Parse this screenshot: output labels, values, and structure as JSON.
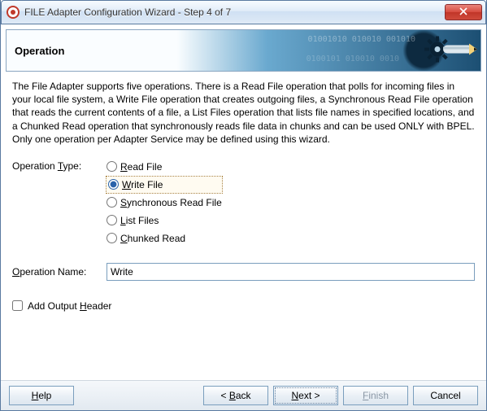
{
  "window": {
    "title": "FILE Adapter Configuration Wizard - Step 4 of 7"
  },
  "header": {
    "title": "Operation"
  },
  "description": "The File Adapter supports five operations.  There is a Read File operation that polls for incoming files in your local file system, a Write File operation that creates outgoing files, a Synchronous Read File operation that reads the current contents of a file, a List Files operation that lists file names in specified locations, and a Chunked Read operation that synchronously reads file data in chunks and can be used ONLY with BPEL. Only one operation per Adapter Service may be defined using this wizard.",
  "form": {
    "operation_type_label": "Operation Type:",
    "operation_type_mnemonic": "T",
    "radios": [
      {
        "text": "Read File",
        "mnemonic": "R",
        "selected": false
      },
      {
        "text": "Write File",
        "mnemonic": "W",
        "selected": true
      },
      {
        "text": "Synchronous Read File",
        "mnemonic": "S",
        "selected": false
      },
      {
        "text": "List Files",
        "mnemonic": "L",
        "selected": false
      },
      {
        "text": "Chunked Read",
        "mnemonic": "C",
        "selected": false
      }
    ],
    "operation_name_label": "Operation Name:",
    "operation_name_mnemonic": "O",
    "operation_name_value": "Write",
    "add_output_header_label": "Add Output Header",
    "add_output_header_mnemonic": "H",
    "add_output_header_checked": false
  },
  "buttons": {
    "help": "Help",
    "back": "< Back",
    "next": "Next >",
    "finish": "Finish",
    "cancel": "Cancel",
    "help_m": "H",
    "back_m": "B",
    "next_m": "N",
    "finish_m": "F"
  }
}
